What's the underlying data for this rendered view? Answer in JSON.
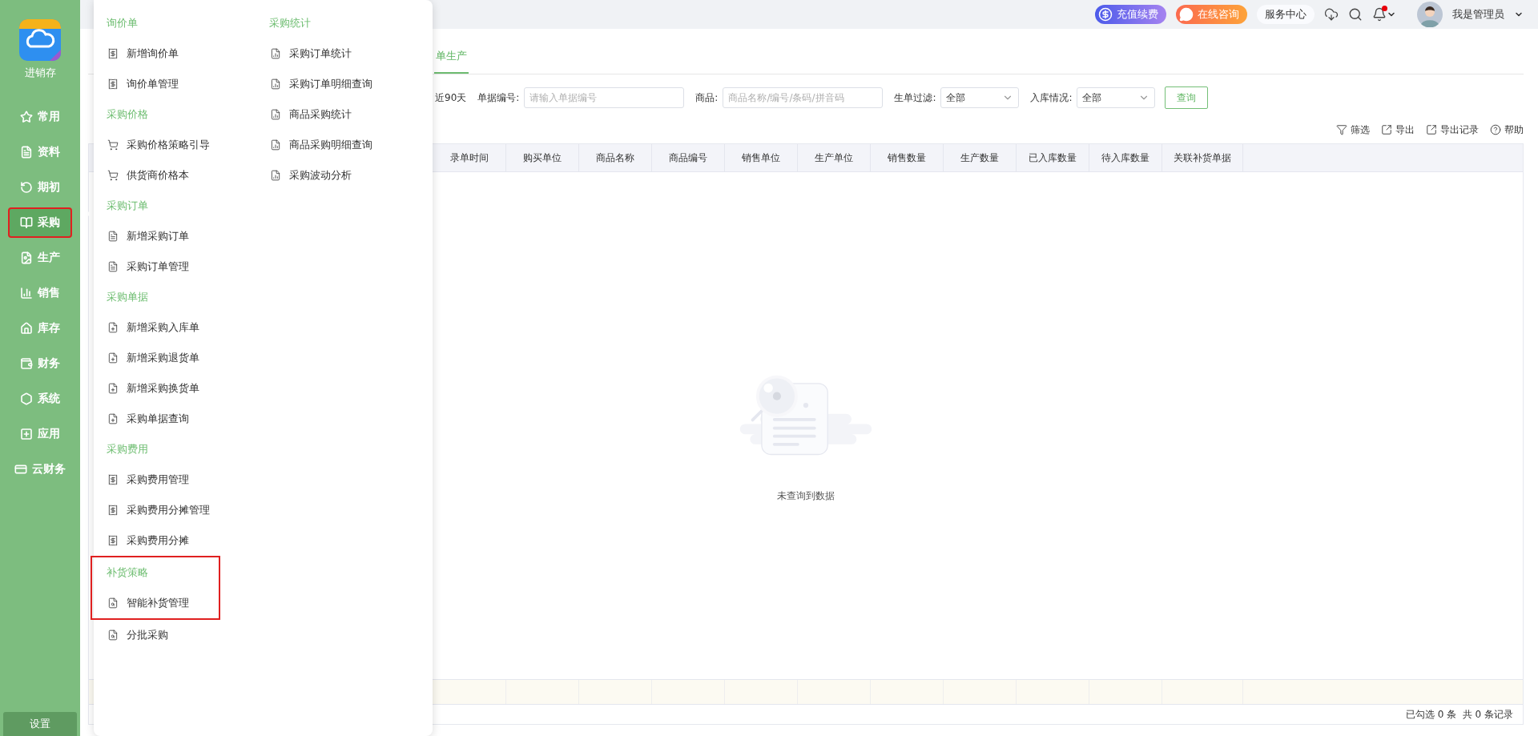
{
  "sidebar": {
    "app_name": "进销存",
    "items": [
      {
        "label": "常用",
        "selected": false,
        "highlighted": false
      },
      {
        "label": "资料",
        "selected": false,
        "highlighted": false
      },
      {
        "label": "期初",
        "selected": false,
        "highlighted": false
      },
      {
        "label": "采购",
        "selected": true,
        "highlighted": true
      },
      {
        "label": "生产",
        "selected": false,
        "highlighted": false
      },
      {
        "label": "销售",
        "selected": false,
        "highlighted": false
      },
      {
        "label": "库存",
        "selected": false,
        "highlighted": false
      },
      {
        "label": "财务",
        "selected": false,
        "highlighted": false
      },
      {
        "label": "系统",
        "selected": false,
        "highlighted": false
      },
      {
        "label": "应用",
        "selected": false,
        "highlighted": false
      },
      {
        "label": "云财务",
        "selected": false,
        "highlighted": false
      }
    ],
    "settings": "设置"
  },
  "header": {
    "buttons": [
      {
        "label": "充值续费",
        "kind": "recharge"
      },
      {
        "label": "在线咨询",
        "kind": "consult"
      },
      {
        "label": "服务中心",
        "kind": "plain"
      }
    ],
    "notification_unread": true,
    "user": "我是管理员"
  },
  "tabs": [
    {
      "label": "单生产",
      "selected": true
    }
  ],
  "filters": {
    "range": "近90天",
    "fields": [
      {
        "label": "单据编号:",
        "kind": "input",
        "placeholder": "请输入单据编号"
      },
      {
        "label": "商品:",
        "kind": "input",
        "placeholder": "商品名称/编号/条码/拼音码"
      },
      {
        "label": "生单过滤:",
        "kind": "select",
        "value": "全部"
      },
      {
        "label": "入库情况:",
        "kind": "select",
        "value": "全部"
      }
    ],
    "search_button": "查询"
  },
  "toolbar": [
    "筛选",
    "导出",
    "导出记录",
    "帮助"
  ],
  "table": {
    "columns": [
      "录单时间",
      "购买单位",
      "商品名称",
      "商品编号",
      "销售单位",
      "生产单位",
      "销售数量",
      "生产数量",
      "已入库数量",
      "待入库数量",
      "关联补货单据"
    ],
    "empty_message": "未查询到数据"
  },
  "status": "已勾选 0 条  共 0 条记录",
  "menu": {
    "columns": [
      {
        "sections": [
          {
            "title": "询价单",
            "items": [
              {
                "label": "新增询价单",
                "highlighted": false
              },
              {
                "label": "询价单管理",
                "highlighted": false
              }
            ]
          },
          {
            "title": "采购价格",
            "items": [
              {
                "label": "采购价格策略引导",
                "highlighted": false
              },
              {
                "label": "供货商价格本",
                "highlighted": false
              }
            ]
          },
          {
            "title": "采购订单",
            "items": [
              {
                "label": "新增采购订单",
                "highlighted": false
              },
              {
                "label": "采购订单管理",
                "highlighted": false
              }
            ]
          },
          {
            "title": "采购单据",
            "items": [
              {
                "label": "新增采购入库单",
                "highlighted": false
              },
              {
                "label": "新增采购退货单",
                "highlighted": false
              },
              {
                "label": "新增采购换货单",
                "highlighted": false
              },
              {
                "label": "采购单据查询",
                "highlighted": false
              }
            ]
          },
          {
            "title": "采购费用",
            "items": [
              {
                "label": "采购费用管理",
                "highlighted": false
              },
              {
                "label": "采购费用分摊管理",
                "highlighted": false
              },
              {
                "label": "采购费用分摊",
                "highlighted": false
              }
            ]
          },
          {
            "title": "补货策略",
            "highlighted": true,
            "items": [
              {
                "label": "智能补货管理",
                "highlighted": true
              },
              {
                "label": "分批采购",
                "highlighted": false
              }
            ]
          }
        ]
      },
      {
        "sections": [
          {
            "title": "采购统计",
            "items": [
              {
                "label": "采购订单统计",
                "highlighted": false
              },
              {
                "label": "采购订单明细查询",
                "highlighted": false
              },
              {
                "label": "商品采购统计",
                "highlighted": false
              },
              {
                "label": "商品采购明细查询",
                "highlighted": false
              },
              {
                "label": "采购波动分析",
                "highlighted": false
              }
            ]
          }
        ]
      }
    ]
  }
}
